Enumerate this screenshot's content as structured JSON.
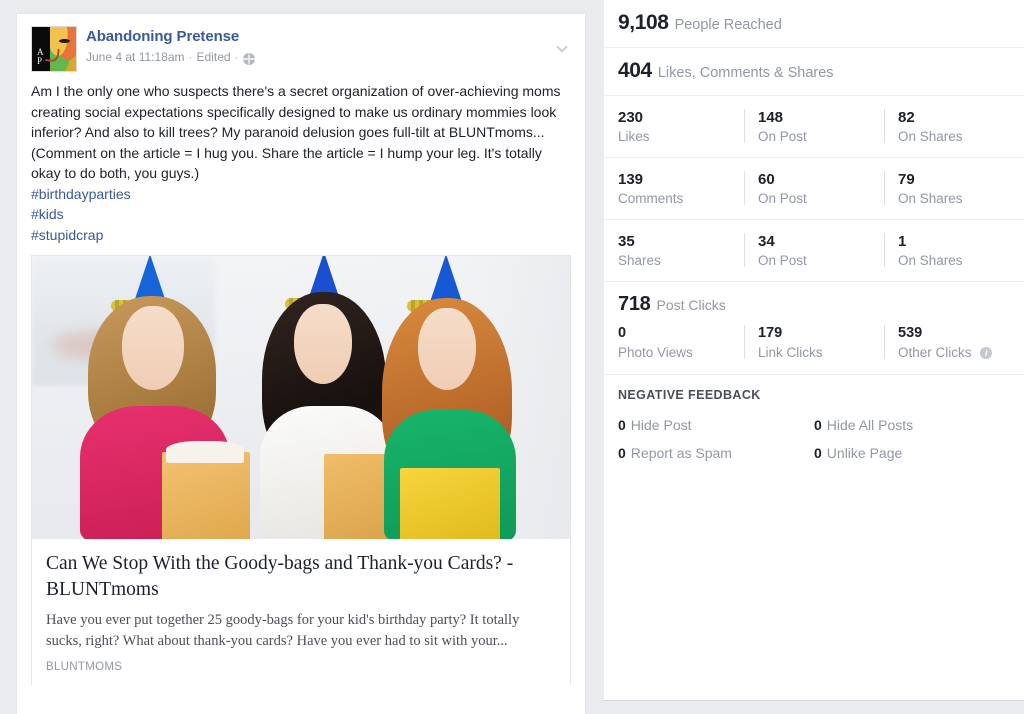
{
  "post": {
    "page_name": "Abandoning Pretense",
    "timestamp": "June 4 at 11:18am",
    "edited_label": "Edited",
    "separator": "·",
    "privacy_icon": "globe-icon",
    "menu_icon": "chevron-down-icon",
    "avatar_monogram": "A\nP",
    "message": "Am I the only one who suspects there's a secret organization of over-achieving moms creating social expectations specifically designed to make us ordinary mommies look inferior? And also to kill trees? My paranoid delusion goes full-tilt at BLUNTmoms... (Comment on the article = I hug you. Share the article = I hump your leg. It's totally okay to do both, you guys.)",
    "hashtags": [
      "#birthdayparties",
      "#kids",
      "#stupidcrap"
    ],
    "link_preview": {
      "title": "Can We Stop With the Goody-bags and Thank-you Cards? - BLUNTmoms",
      "description": "Have you ever put together 25 goody-bags for your kid's birthday party? It totally sucks, right? What about thank-you cards? Have you ever had to sit with your...",
      "domain": "BLUNTMOMS",
      "image_alt": "Three women wearing blue party hats holding gift boxes and blowing party horns"
    },
    "colors": {
      "link": "#3b5998",
      "text": "#1d2129",
      "muted": "#9197a3"
    }
  },
  "insights": {
    "reach": {
      "value": "9,108",
      "label": "People Reached"
    },
    "engagement": {
      "value": "404",
      "label": "Likes, Comments & Shares"
    },
    "rows": [
      {
        "total": {
          "value": "230",
          "label": "Likes"
        },
        "on_post": {
          "value": "148",
          "label": "On Post"
        },
        "on_shares": {
          "value": "82",
          "label": "On Shares"
        }
      },
      {
        "total": {
          "value": "139",
          "label": "Comments"
        },
        "on_post": {
          "value": "60",
          "label": "On Post"
        },
        "on_shares": {
          "value": "79",
          "label": "On Shares"
        }
      },
      {
        "total": {
          "value": "35",
          "label": "Shares"
        },
        "on_post": {
          "value": "34",
          "label": "On Post"
        },
        "on_shares": {
          "value": "1",
          "label": "On Shares"
        }
      }
    ],
    "clicks": {
      "total": {
        "value": "718",
        "label": "Post Clicks"
      },
      "photo_views": {
        "value": "0",
        "label": "Photo Views"
      },
      "link_clicks": {
        "value": "179",
        "label": "Link Clicks"
      },
      "other_clicks": {
        "value": "539",
        "label": "Other Clicks",
        "info_icon": "info-icon"
      }
    },
    "negative_feedback": {
      "title": "NEGATIVE FEEDBACK",
      "items": [
        {
          "value": "0",
          "label": "Hide Post"
        },
        {
          "value": "0",
          "label": "Hide All Posts"
        },
        {
          "value": "0",
          "label": "Report as Spam"
        },
        {
          "value": "0",
          "label": "Unlike Page"
        }
      ]
    }
  }
}
